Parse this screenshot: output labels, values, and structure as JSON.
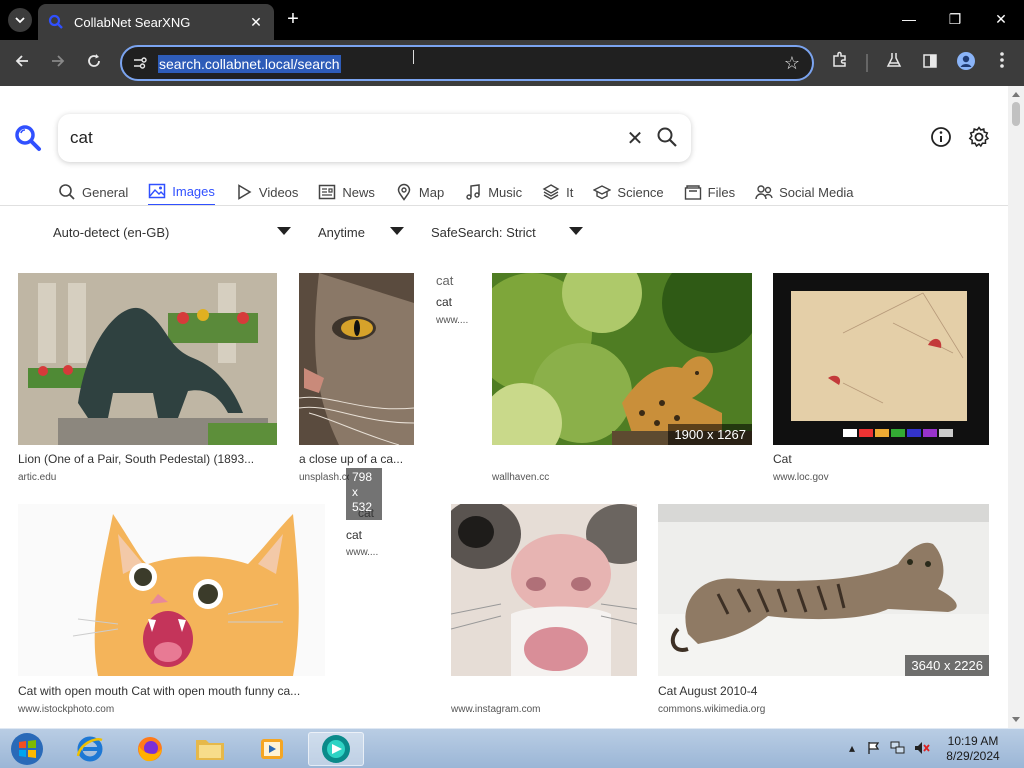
{
  "browser": {
    "tab_title": "CollabNet SearXNG",
    "url": "search.collabnet.local/search"
  },
  "search": {
    "query": "cat"
  },
  "categories": [
    {
      "label": "General",
      "icon": "search-icon"
    },
    {
      "label": "Images",
      "icon": "image-icon",
      "active": true
    },
    {
      "label": "Videos",
      "icon": "play-icon"
    },
    {
      "label": "News",
      "icon": "newspaper-icon"
    },
    {
      "label": "Map",
      "icon": "map-pin-icon"
    },
    {
      "label": "Music",
      "icon": "music-icon"
    },
    {
      "label": "It",
      "icon": "layers-icon"
    },
    {
      "label": "Science",
      "icon": "school-icon"
    },
    {
      "label": "Files",
      "icon": "files-icon"
    },
    {
      "label": "Social Media",
      "icon": "people-icon"
    }
  ],
  "filters": {
    "language": "Auto-detect (en-GB)",
    "time": "Anytime",
    "safesearch": "SafeSearch: Strict"
  },
  "results": [
    {
      "caption": "Lion (One of a Pair, South Pedestal) (1893...",
      "source": "artic.edu"
    },
    {
      "caption": "a close up of a ca...",
      "source": "unsplash.co"
    },
    {
      "alt": "cat",
      "caption": "cat",
      "source": "www...."
    },
    {
      "caption": "",
      "source": "wallhaven.cc",
      "dims": "1900 x 1267"
    },
    {
      "caption": "Cat",
      "source": "www.loc.gov"
    },
    {
      "caption": "Cat with open mouth Cat with open mouth funny ca...",
      "source": "www.istockphoto.com"
    },
    {
      "alt": "cat",
      "caption": "cat",
      "source": "www....",
      "dims_lines": [
        "798",
        "x",
        "532"
      ]
    },
    {
      "caption": "",
      "source": "www.instagram.com"
    },
    {
      "caption": "Cat August 2010-4",
      "source": "commons.wikimedia.org",
      "dims": "3640 x 2226"
    }
  ],
  "taskbar": {
    "time": "10:19 AM",
    "date": "8/29/2024"
  },
  "colors": {
    "accent": "#3050ff",
    "tab_bg": "#3c3c3c",
    "chrome_bg": "#000000"
  }
}
